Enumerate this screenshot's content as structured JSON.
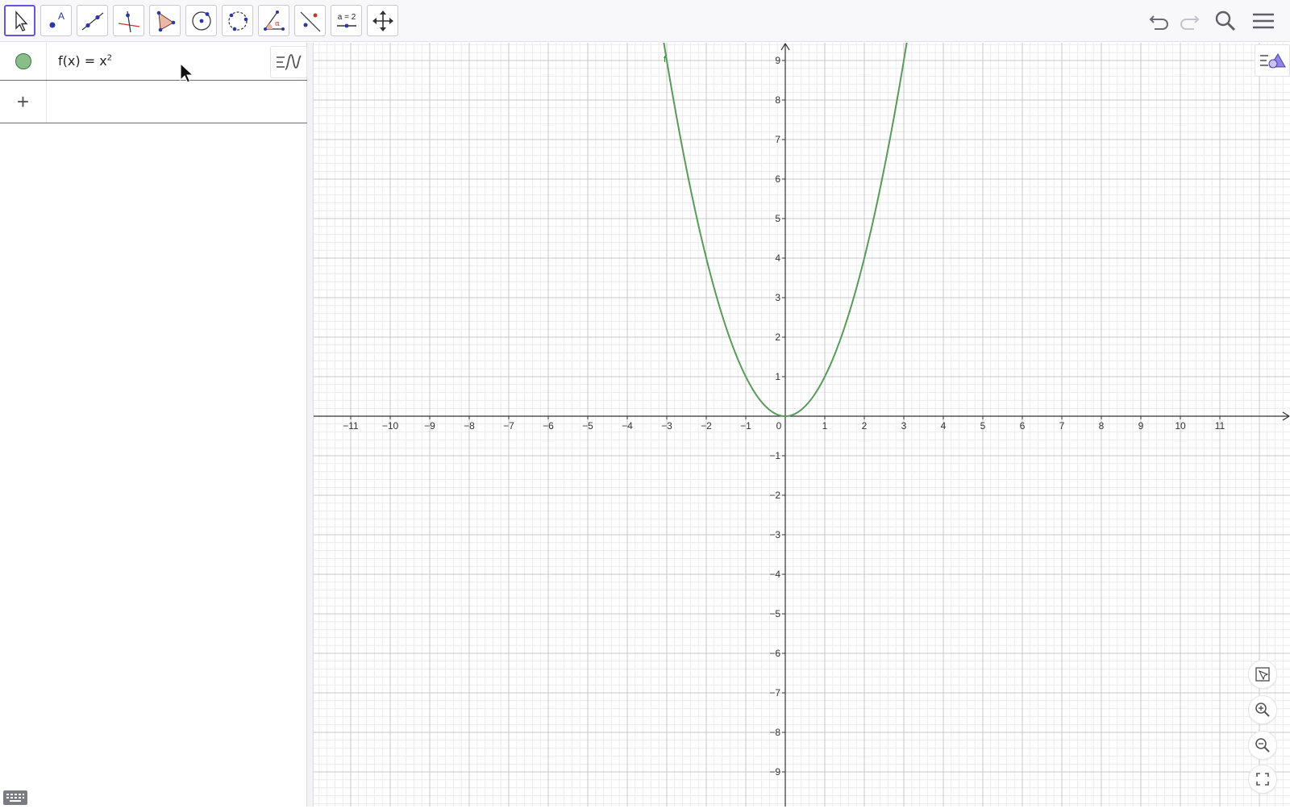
{
  "toolbar": {
    "tools": [
      {
        "name": "move-tool",
        "icon": "arrow-pointer-icon",
        "active": true
      },
      {
        "name": "point-tool",
        "icon": "point-icon",
        "label": "A"
      },
      {
        "name": "line-tool",
        "icon": "line-icon"
      },
      {
        "name": "perpendicular-line-tool",
        "icon": "perpendicular-line-icon"
      },
      {
        "name": "polygon-tool",
        "icon": "polygon-icon"
      },
      {
        "name": "circle-tool",
        "icon": "circle-center-point-icon"
      },
      {
        "name": "circle-three-points-tool",
        "icon": "circle-three-points-icon"
      },
      {
        "name": "angle-tool",
        "icon": "angle-icon",
        "label": "α"
      },
      {
        "name": "reflect-tool",
        "icon": "reflect-line-icon"
      },
      {
        "name": "slider-tool",
        "icon": "slider-icon",
        "label": "a = 2"
      },
      {
        "name": "move-graphics-tool",
        "icon": "move-arrows-icon"
      }
    ],
    "right": [
      "undo-icon",
      "redo-icon",
      "search-icon",
      "menu-icon"
    ]
  },
  "algebra": {
    "entries": [
      {
        "name": "f",
        "lhs": "f(x)",
        "eq": "=",
        "base": "x",
        "exp": "2",
        "color": "#89bd89"
      }
    ],
    "add_input": "+"
  },
  "graphics": {
    "function_label": "f",
    "curve_color": "#5a9a5a",
    "axis_color": "#333333",
    "grid_major": "#c8c8c8",
    "grid_minor": "#ececec"
  },
  "chart_data": {
    "type": "line",
    "series": [
      {
        "name": "f",
        "x": [
          -3.1,
          -3,
          -2.5,
          -2,
          -1.5,
          -1,
          -0.5,
          0,
          0.5,
          1,
          1.5,
          2,
          2.5,
          3,
          3.1
        ],
        "y": [
          9.61,
          9,
          6.25,
          4,
          2.25,
          1,
          0.25,
          0,
          0.25,
          1,
          2.25,
          4,
          6.25,
          9,
          9.61
        ]
      }
    ],
    "xlim": [
      -12,
      12
    ],
    "ylim": [
      -9.5,
      9.5
    ],
    "x_ticks": [
      "-11",
      "-10",
      "-9",
      "-8",
      "-7",
      "-6",
      "-5",
      "-4",
      "-3",
      "-2",
      "-1",
      "0",
      "1",
      "2",
      "3",
      "4",
      "5",
      "6",
      "7",
      "8",
      "9",
      "10",
      "11"
    ],
    "y_ticks": [
      "-9",
      "-8",
      "-7",
      "-6",
      "-5",
      "-4",
      "-3",
      "-2",
      "-1",
      "1",
      "2",
      "3",
      "4",
      "5",
      "6",
      "7",
      "8",
      "9"
    ],
    "grid": true
  }
}
